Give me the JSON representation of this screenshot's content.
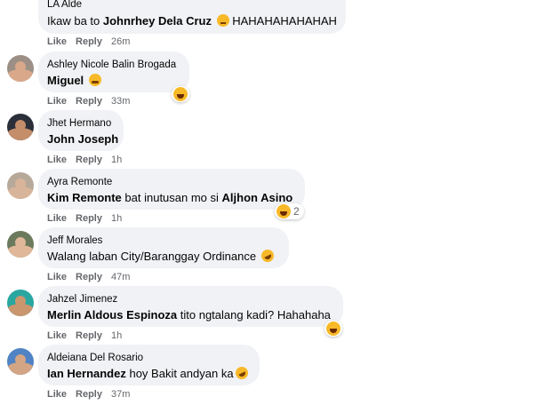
{
  "labels": {
    "like": "Like",
    "reply": "Reply"
  },
  "comments": [
    {
      "author": "LA Alde",
      "parts": [
        {
          "t": "Ikaw ba to ",
          "b": false
        },
        {
          "t": "Johnrhey Dela Cruz",
          "b": true
        },
        {
          "t": " ",
          "b": false
        }
      ],
      "emoji": "thinking-emoji",
      "after": " HAHAHAHAHAHAH",
      "time": "26m",
      "reaction": null
    },
    {
      "author": "Ashley Nicole Balin Brogada",
      "parts": [
        {
          "t": "Miguel",
          "b": true
        },
        {
          "t": " ",
          "b": false
        }
      ],
      "emoji": "crying-emoji",
      "after": "",
      "time": "33m",
      "reaction": {
        "count": ""
      }
    },
    {
      "author": "Jhet Hermano",
      "parts": [
        {
          "t": "John Joseph",
          "b": true
        }
      ],
      "emoji": null,
      "after": "",
      "time": "1h",
      "reaction": null
    },
    {
      "author": "Ayra Remonte",
      "parts": [
        {
          "t": "Kim Remonte",
          "b": true
        },
        {
          "t": " bat inutusan mo si ",
          "b": false
        },
        {
          "t": "Aljhon Asino",
          "b": true
        }
      ],
      "emoji": null,
      "after": "",
      "time": "1h",
      "reaction": {
        "count": "2"
      }
    },
    {
      "author": "Jeff Morales",
      "parts": [
        {
          "t": "Walang laban City/Baranggay Ordinance ",
          "b": false
        }
      ],
      "emoji": "rofl-emoji",
      "after": "",
      "time": "47m",
      "reaction": null
    },
    {
      "author": "Jahzel Jimenez",
      "parts": [
        {
          "t": "Merlin Aldous Espinoza",
          "b": true
        },
        {
          "t": " tito ngtalang kadi? Hahahaha",
          "b": false
        }
      ],
      "emoji": null,
      "after": "",
      "time": "1h",
      "reaction": {
        "count": ""
      }
    },
    {
      "author": "Aldeiana Del Rosario",
      "parts": [
        {
          "t": "Ian Hernandez",
          "b": true
        },
        {
          "t": " hoy Bakit andyan ka",
          "b": false
        }
      ],
      "emoji": "rofl-emoji",
      "after": "",
      "time": "37m",
      "reaction": null
    }
  ],
  "colors": {
    "bubble": "#f0f2f5",
    "meta": "#65676b",
    "haha": "#f7b928"
  }
}
